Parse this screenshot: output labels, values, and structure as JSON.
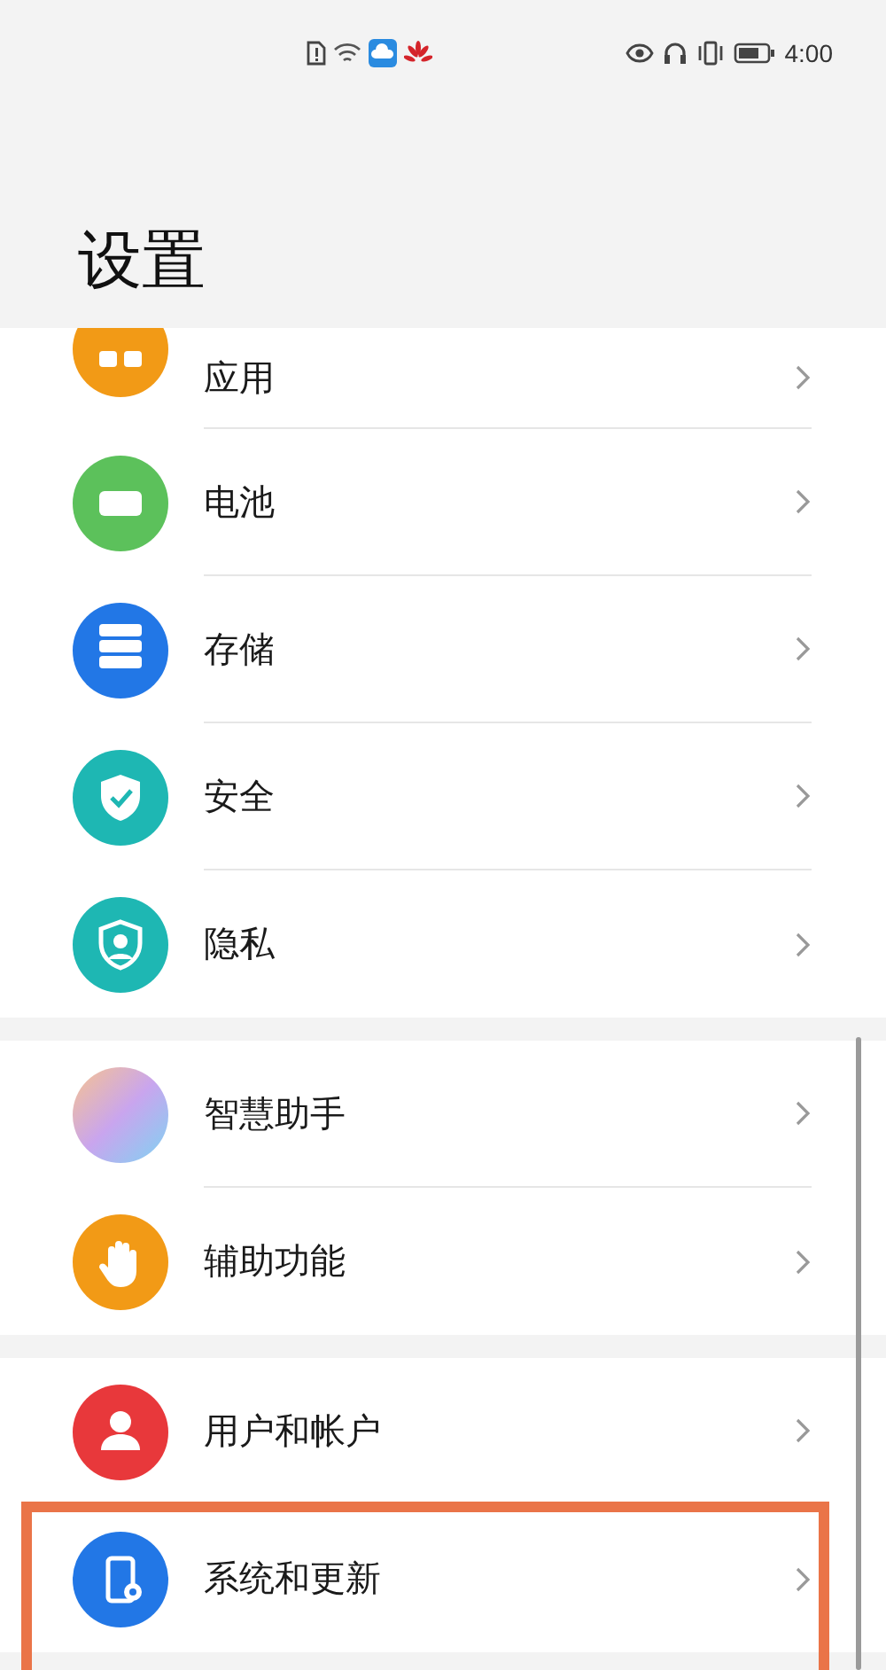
{
  "status_bar": {
    "time": "4:00"
  },
  "title": "设置",
  "groups": [
    {
      "items": [
        {
          "label": "应用",
          "kind": "apps",
          "color": "#f29a16",
          "cut_off": true,
          "highlighted": false
        },
        {
          "label": "电池",
          "kind": "battery",
          "color": "#5cc15b",
          "cut_off": false,
          "highlighted": false
        },
        {
          "label": "存储",
          "kind": "storage",
          "color": "#2277e6",
          "cut_off": false,
          "highlighted": false
        },
        {
          "label": "安全",
          "kind": "security",
          "color": "#1eb7b3",
          "cut_off": false,
          "highlighted": false
        },
        {
          "label": "隐私",
          "kind": "privacy",
          "color": "#1eb7b3",
          "cut_off": false,
          "highlighted": false
        }
      ]
    },
    {
      "items": [
        {
          "label": "智慧助手",
          "kind": "assistant",
          "color": "#c9a5ee",
          "cut_off": false,
          "highlighted": false
        },
        {
          "label": "辅助功能",
          "kind": "accessibility",
          "color": "#f29a16",
          "cut_off": false,
          "highlighted": false
        }
      ]
    },
    {
      "items": [
        {
          "label": "用户和帐户",
          "kind": "user",
          "color": "#e8383b",
          "cut_off": false,
          "highlighted": false
        },
        {
          "label": "系统和更新",
          "kind": "system",
          "color": "#2277e6",
          "cut_off": false,
          "highlighted": true
        }
      ]
    }
  ]
}
